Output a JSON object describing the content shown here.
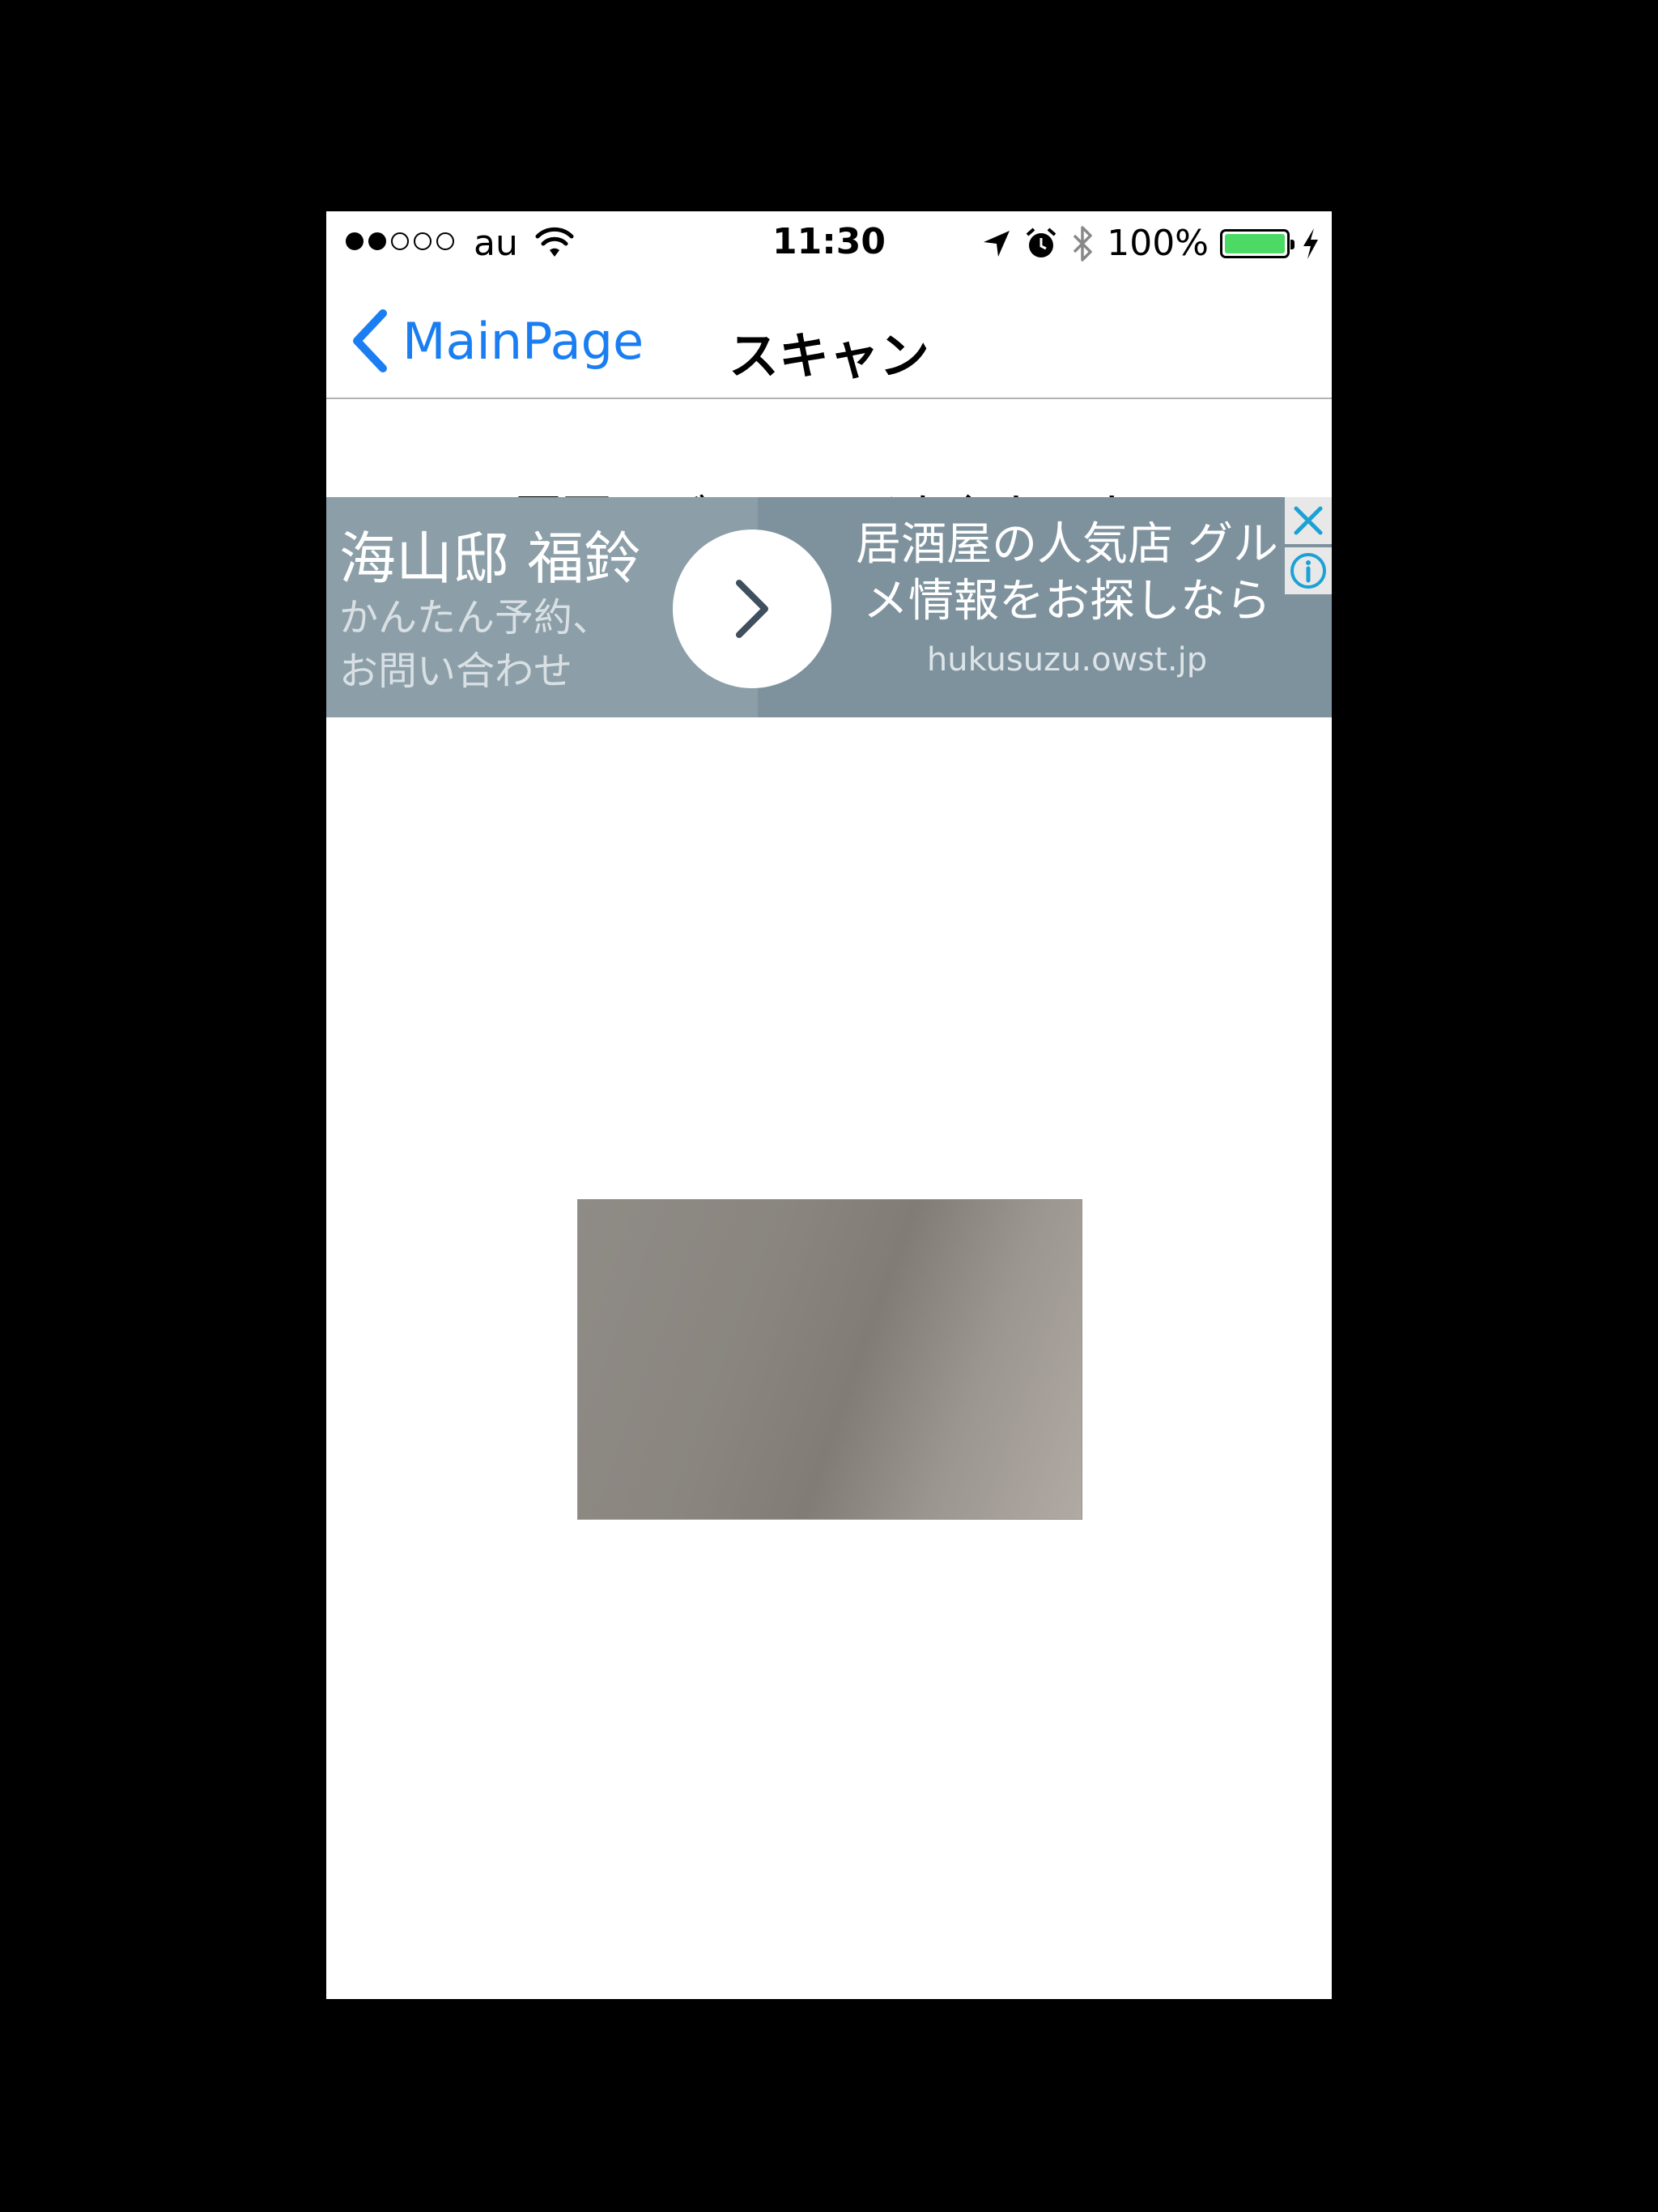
{
  "status_bar": {
    "signal_dots_filled": 2,
    "signal_dots_total": 5,
    "carrier": "au",
    "time": "11:30",
    "battery_percent": "100%",
    "battery_level": 1.0,
    "icons": [
      "wifi-icon",
      "location-arrow-icon",
      "alarm-icon",
      "bluetooth-icon",
      "battery-icon",
      "charging-icon"
    ]
  },
  "nav": {
    "back_label": "MainPage",
    "title": "スキャン"
  },
  "instruction": "画面にバーコードを入れてね",
  "ad": {
    "brand": "海山邸 福鈴",
    "sub_line1": "かんたん予約、",
    "sub_line2": "お問い合わせ",
    "headline_line1": "居酒屋の人気店 グル",
    "headline_line2": "メ情報をお探しなら",
    "url": "hukusuzu.owst.jp",
    "colors": {
      "background": "#7e929e",
      "left_panel": "#8c9ea8",
      "accent": "#1ba1d6"
    }
  },
  "colors": {
    "accent": "#1a7ef2",
    "battery": "#4cd964"
  }
}
